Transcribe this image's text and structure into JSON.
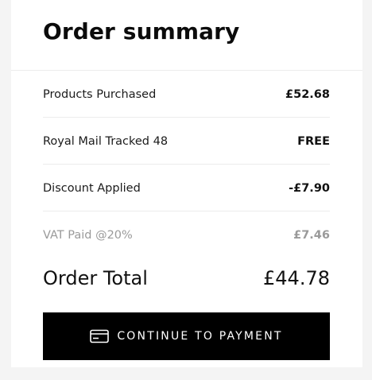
{
  "header": {
    "title": "Order summary"
  },
  "summary": {
    "rows": [
      {
        "label": "Products Purchased",
        "value": "£52.68"
      },
      {
        "label": "Royal Mail Tracked 48",
        "value": "FREE"
      },
      {
        "label": "Discount Applied",
        "value": "-£7.90"
      },
      {
        "label": "VAT Paid @20%",
        "value": "£7.46"
      }
    ],
    "total_label": "Order Total",
    "total_value": "£44.78"
  },
  "actions": {
    "continue_label": "CONTINUE TO PAYMENT",
    "continue_icon": "credit-card-icon"
  },
  "colors": {
    "button_background": "#000000",
    "button_text": "#ffffff",
    "muted_text": "#9a9a9a",
    "page_background": "#f4f4f4",
    "card_background": "#ffffff"
  }
}
